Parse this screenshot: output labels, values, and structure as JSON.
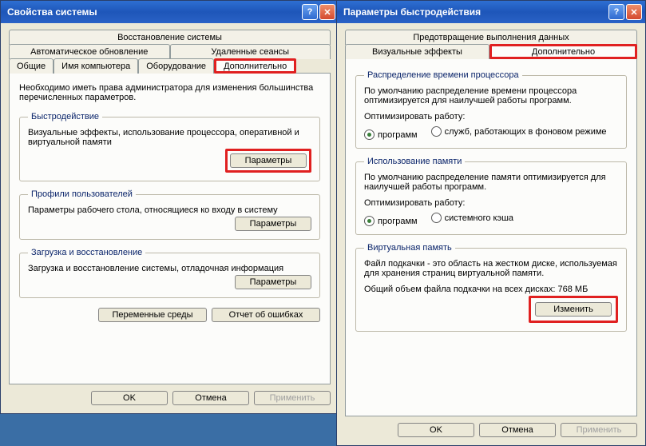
{
  "win1": {
    "title": "Свойства системы",
    "tabs_row1": [
      "Восстановление системы"
    ],
    "tabs_row2": [
      "Автоматическое обновление",
      "Удаленные сеансы"
    ],
    "tabs_row3": [
      "Общие",
      "Имя компьютера",
      "Оборудование",
      "Дополнительно"
    ],
    "intro": "Необходимо иметь права администратора для изменения большинства перечисленных параметров.",
    "grp_perf": {
      "legend": "Быстродействие",
      "text": "Визуальные эффекты, использование процессора, оперативной и виртуальной памяти",
      "btn": "Параметры"
    },
    "grp_profiles": {
      "legend": "Профили пользователей",
      "text": "Параметры рабочего стола, относящиеся ко входу в систему",
      "btn": "Параметры"
    },
    "grp_startup": {
      "legend": "Загрузка и восстановление",
      "text": "Загрузка и восстановление системы, отладочная информация",
      "btn": "Параметры"
    },
    "env_btn": "Переменные среды",
    "err_btn": "Отчет об ошибках",
    "ok": "OK",
    "cancel": "Отмена",
    "apply": "Применить"
  },
  "win2": {
    "title": "Параметры быстродействия",
    "tabs_row1": [
      "Предотвращение выполнения данных"
    ],
    "tabs_row2": [
      "Визуальные эффекты",
      "Дополнительно"
    ],
    "grp_cpu": {
      "legend": "Распределение времени процессора",
      "text": "По умолчанию распределение времени процессора оптимизируется для наилучшей работы программ.",
      "label": "Оптимизировать работу:",
      "opt1": "программ",
      "opt2": "служб, работающих в фоновом режиме"
    },
    "grp_mem": {
      "legend": "Использование памяти",
      "text": "По умолчанию распределение памяти оптимизируется для наилучшей работы программ.",
      "label": "Оптимизировать работу:",
      "opt1": "программ",
      "opt2": "системного кэша"
    },
    "grp_vm": {
      "legend": "Виртуальная память",
      "text": "Файл подкачки - это область на жестком диске, используемая для хранения страниц виртуальной памяти.",
      "total": "Общий объем файла подкачки на всех дисках:  768 МБ",
      "btn": "Изменить"
    },
    "ok": "OK",
    "cancel": "Отмена",
    "apply": "Применить"
  }
}
